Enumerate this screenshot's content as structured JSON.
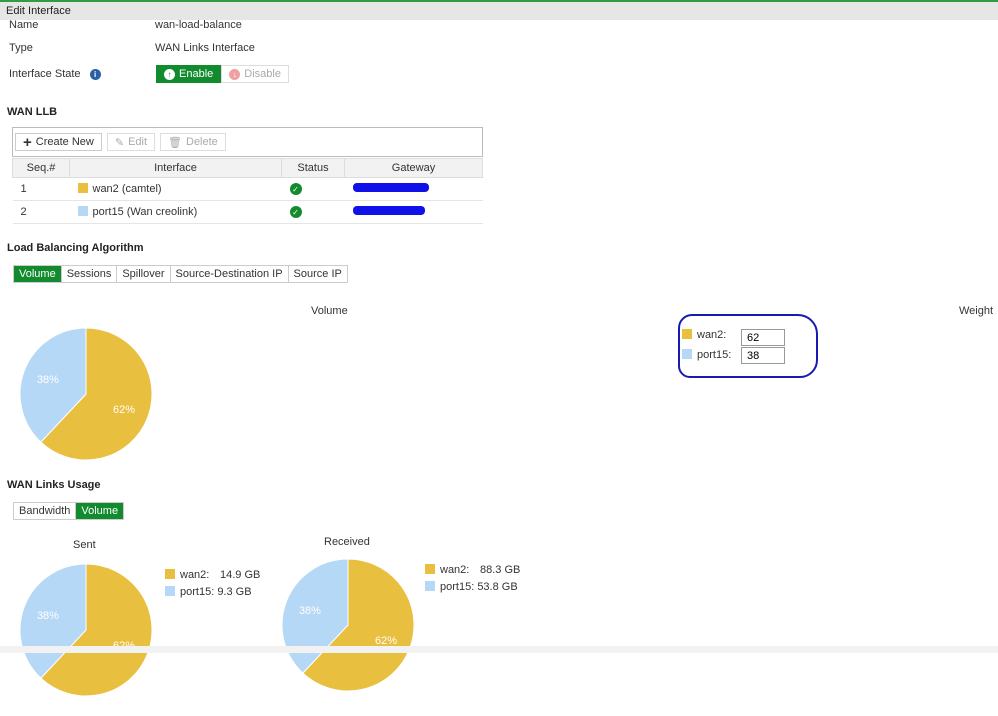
{
  "header": {
    "title": "Edit Interface"
  },
  "form": {
    "name_label": "Name",
    "name_value": "wan-load-balance",
    "type_label": "Type",
    "type_value": "WAN Links Interface",
    "state_label": "Interface State",
    "enable": "Enable",
    "disable": "Disable"
  },
  "wanllb": {
    "title": "WAN LLB",
    "create": "Create New",
    "edit": "Edit",
    "delete": "Delete",
    "columns": [
      "Seq.#",
      "Interface",
      "Status",
      "Gateway"
    ],
    "rows": [
      {
        "seq": "1",
        "iface": "wan2 (camtel)",
        "color": "#e9bf3f"
      },
      {
        "seq": "2",
        "iface": "port15 (Wan creolink)",
        "color": "#b4d8f5"
      }
    ]
  },
  "lba": {
    "title": "Load Balancing Algorithm",
    "tabs": [
      "Volume",
      "Sessions",
      "Spillover",
      "Source-Destination IP",
      "Source IP"
    ],
    "chart_title": "Volume",
    "weight_title": "Weight",
    "weights": [
      {
        "label": "wan2:",
        "value": "62"
      },
      {
        "label": "port15:",
        "value": "38"
      }
    ]
  },
  "usage": {
    "title": "WAN Links Usage",
    "tabs": [
      "Bandwidth",
      "Volume"
    ],
    "sent": {
      "title": "Sent",
      "legend": [
        {
          "label": "wan2:",
          "value": "14.9 GB"
        },
        {
          "label": "port15:",
          "value": "9.3 GB"
        }
      ]
    },
    "received": {
      "title": "Received",
      "legend": [
        {
          "label": "wan2:",
          "value": "88.3 GB"
        },
        {
          "label": "port15:",
          "value": "53.8 GB"
        }
      ]
    }
  },
  "chart_data": [
    {
      "type": "pie",
      "title": "Volume",
      "categories": [
        "wan2",
        "port15"
      ],
      "values": [
        62,
        38
      ],
      "labels": [
        "62%",
        "38%"
      ],
      "colors": [
        "#e9bf3f",
        "#b4d8f5"
      ]
    },
    {
      "type": "pie",
      "title": "Sent",
      "categories": [
        "wan2",
        "port15"
      ],
      "values": [
        62,
        38
      ],
      "labels": [
        "62%",
        "38%"
      ],
      "colors": [
        "#e9bf3f",
        "#b4d8f5"
      ]
    },
    {
      "type": "pie",
      "title": "Received",
      "categories": [
        "wan2",
        "port15"
      ],
      "values": [
        62,
        38
      ],
      "labels": [
        "62%",
        "38%"
      ],
      "colors": [
        "#e9bf3f",
        "#b4d8f5"
      ]
    }
  ]
}
